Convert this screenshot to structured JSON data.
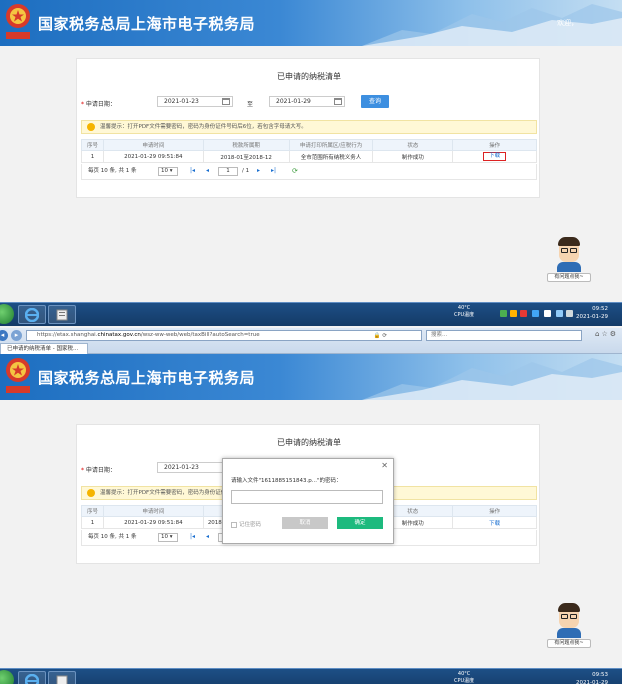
{
  "header": {
    "title": "国家税务总局上海市电子税务局",
    "welcome": "欢迎，",
    "emblem_text": "中国税务"
  },
  "page": {
    "title": "已申请的纳税清单",
    "date_label": "申请日期：",
    "date_from": "2021-01-23",
    "to_label": "至",
    "date_to": "2021-01-29",
    "query_button": "查询",
    "tip": "温馨提示：打开PDF文件需要密码，密码为身份证件号码后6位，若包含字母请大写。",
    "table": {
      "headers": [
        "序号",
        "申请时间",
        "税款所属期",
        "申请打印所属区/应税行为",
        "状态",
        "操作"
      ],
      "rows": [
        [
          "1",
          "2021-01-29 09:51:84",
          "2018-01至2018-12",
          "全市范围所有纳税义务人",
          "制作成功",
          "下载"
        ]
      ]
    },
    "pager": {
      "per_page": "每页 10 条, 共 1 条",
      "page_size": "10 ▾",
      "current_page": "1",
      "total_pages": "/ 1"
    }
  },
  "helper": {
    "label": "有问题点我~"
  },
  "taskbar": {
    "temp_top": "40°C",
    "temp_bottom": "CPU温度",
    "time_1": "09:52",
    "date_1": "2021-01-29",
    "time_2": "09:53",
    "date_2": "2021-01-29"
  },
  "browser": {
    "url_prefix": "https://etax.shanghai.",
    "url_domain": "chinatax.gov.cn",
    "url_suffix": "/wsz-ww-web/web/taxBill?autoSearch=true",
    "search_placeholder": "搜索...",
    "tab_title": "已申请的纳税清单 - 国家税..."
  },
  "dialog": {
    "prompt": "请输入文件\"1611885151843.p...\"的密码：",
    "remember": "记住密码",
    "cancel": "取消",
    "ok": "确定"
  },
  "second_table_row": [
    "1",
    "2021-01-29 09:51:84",
    "2018",
    "制作成功",
    "下载"
  ],
  "colors": {
    "banner_blue": "#1d6ec0",
    "query_blue": "#3d8fe0",
    "ok_green": "#1dba7e",
    "download_red_frame": "#d22"
  }
}
